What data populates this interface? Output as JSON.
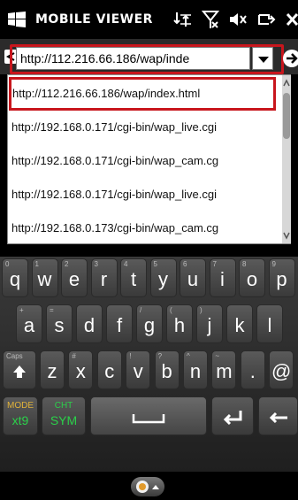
{
  "statusbar": {
    "title": "MOBILE VIEWER",
    "icons": [
      "windows-logo-icon",
      "connectivity-icon",
      "signal-off-icon",
      "volume-muted-icon",
      "battery-charging-icon",
      "close-icon"
    ]
  },
  "address": {
    "value": "http://112.216.66.186/wap/inde"
  },
  "dropdown": {
    "items": [
      "http://112.216.66.186/wap/index.html",
      "http://192.168.0.171/cgi-bin/wap_live.cgi",
      "http://192.168.0.171/cgi-bin/wap_cam.cg",
      "http://192.168.0.171/cgi-bin/wap_live.cgi",
      "http://192.168.0.173/cgi-bin/wap_cam.cg"
    ],
    "selected_index": 0
  },
  "keyboard": {
    "row1": [
      {
        "k": "q",
        "h": "0"
      },
      {
        "k": "w",
        "h": "1"
      },
      {
        "k": "e",
        "h": "2"
      },
      {
        "k": "r",
        "h": "3"
      },
      {
        "k": "t",
        "h": "4"
      },
      {
        "k": "y",
        "h": "5"
      },
      {
        "k": "u",
        "h": "6"
      },
      {
        "k": "i",
        "h": "7"
      },
      {
        "k": "o",
        "h": "8"
      },
      {
        "k": "p",
        "h": "9"
      }
    ],
    "row2": [
      {
        "k": "a",
        "h": "+"
      },
      {
        "k": "s",
        "h": "="
      },
      {
        "k": "d",
        "h": ""
      },
      {
        "k": "f",
        "h": ""
      },
      {
        "k": "g",
        "h": "/"
      },
      {
        "k": "h",
        "h": "("
      },
      {
        "k": "j",
        "h": ")"
      },
      {
        "k": "k",
        "h": ""
      },
      {
        "k": "l",
        "h": ""
      }
    ],
    "row3": [
      {
        "k": "z",
        "h": ""
      },
      {
        "k": "x",
        "h": "#"
      },
      {
        "k": "c",
        "h": ""
      },
      {
        "k": "v",
        "h": "!"
      },
      {
        "k": "b",
        "h": "?"
      },
      {
        "k": "n",
        "h": "^"
      },
      {
        "k": "m",
        "h": "~"
      },
      {
        "k": ".",
        "h": ""
      },
      {
        "k": "@",
        "h": ""
      }
    ],
    "caps_hint": "Caps",
    "mode_top": "MODE",
    "mode_bot": "xt9",
    "cht_top": "CHT",
    "cht_bot": "SYM"
  }
}
